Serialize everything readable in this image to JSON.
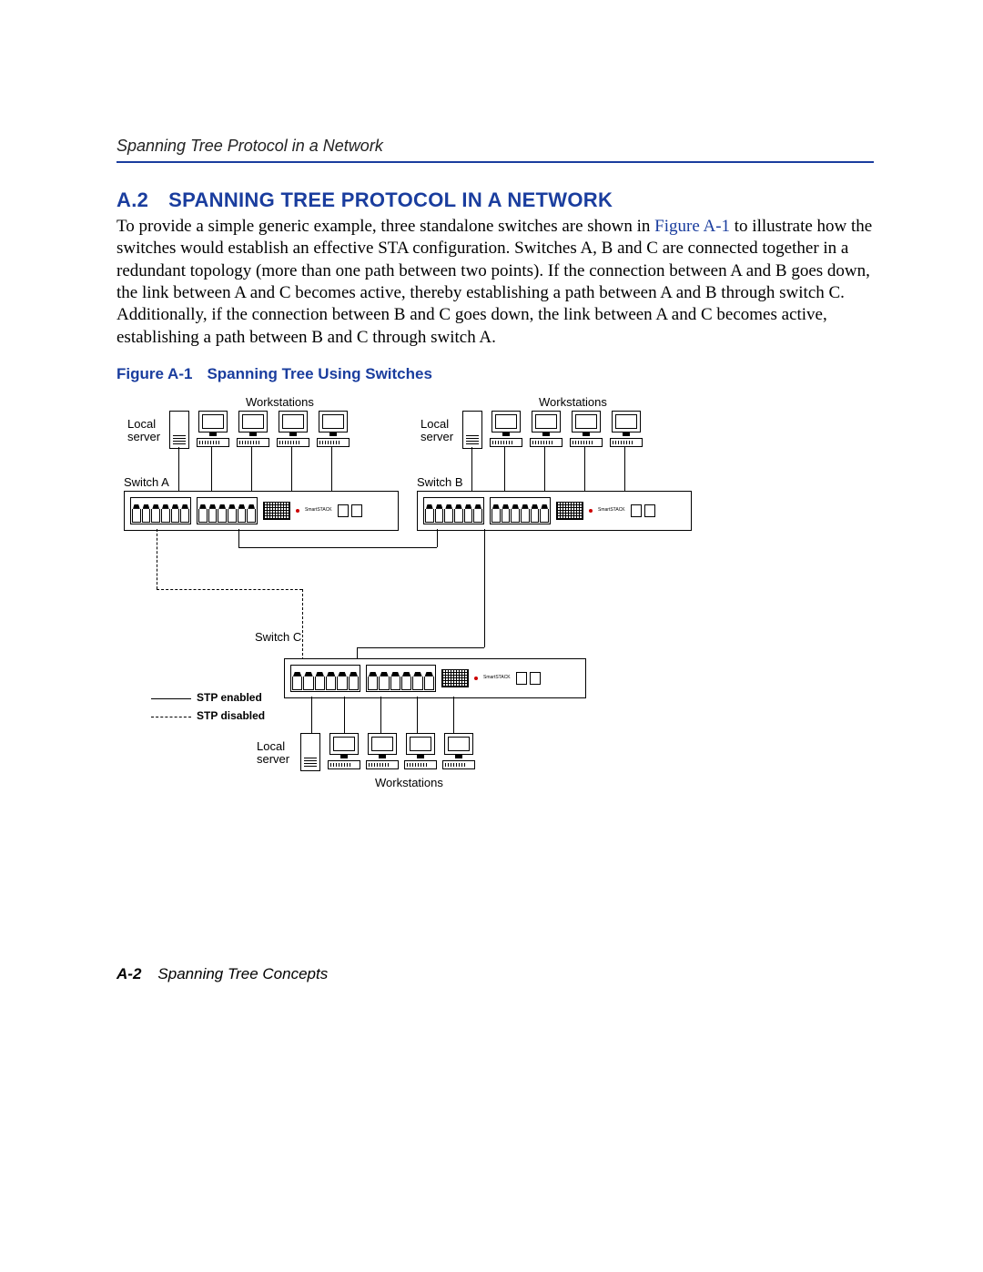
{
  "running_head": "Spanning Tree Protocol in a Network",
  "section": {
    "number": "A.2",
    "title": "SPANNING TREE PROTOCOL IN A NETWORK"
  },
  "paragraph": {
    "pre": "To provide a simple generic example, three standalone switches are shown in ",
    "link": "Figure A-1",
    "post": " to illustrate how the switches would establish an effective STA configuration. Switches A, B and C are connected together in a redundant topology (more than one path between two points). If the connection between A and B goes down, the link between A and C becomes active, thereby establishing a path between A and B through switch C. Additionally, if the connection between B and C goes down, the link between A and C becomes active, establishing a path between B and C through switch A."
  },
  "figure": {
    "number": "Figure A-1",
    "title": "Spanning Tree Using Switches",
    "labels": {
      "workstations_top_left": "Workstations",
      "workstations_top_right": "Workstations",
      "workstations_bottom": "Workstations",
      "local_server_a": "Local\nserver",
      "local_server_b": "Local\nserver",
      "local_server_c": "Local\nserver",
      "switch_a": "Switch A",
      "switch_b": "Switch B",
      "switch_c": "Switch C",
      "legend_enabled": "STP enabled",
      "legend_disabled": "STP disabled"
    }
  },
  "footer": {
    "page": "A-2",
    "title": "Spanning Tree Concepts"
  }
}
